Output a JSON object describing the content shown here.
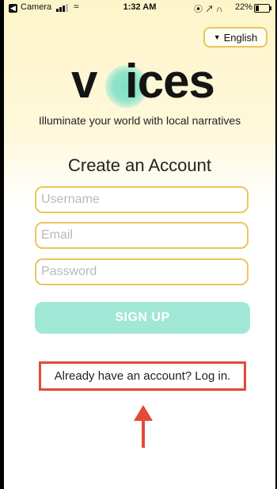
{
  "status_bar": {
    "back_label": "Camera",
    "time": "1:32 AM",
    "indicators": "⦿ ↗ ∩",
    "battery": "22%"
  },
  "language": {
    "label": "English"
  },
  "logo": {
    "text": "voices"
  },
  "tagline": "Illuminate your world with local narratives",
  "form": {
    "title": "Create an Account",
    "username_placeholder": "Username",
    "email_placeholder": "Email",
    "password_placeholder": "Password",
    "signup_label": "SIGN UP",
    "login_link": "Already have an account? Log in."
  },
  "colors": {
    "accent": "#a1e7d5",
    "field_border": "#e9c65d",
    "highlight": "#e34a37"
  }
}
